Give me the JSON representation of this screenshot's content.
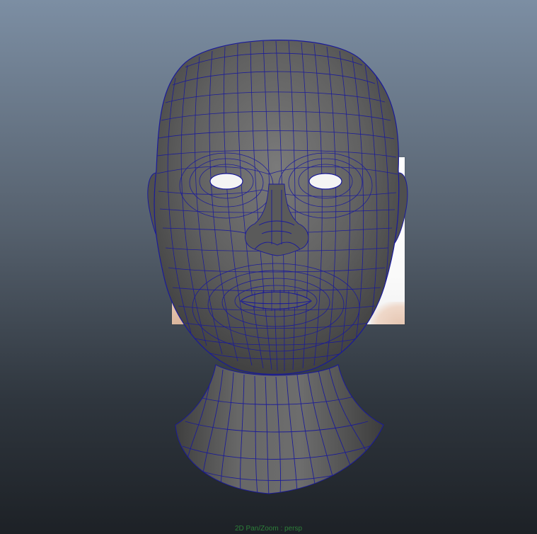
{
  "viewport": {
    "hud_label": "2D Pan/Zoom : persp",
    "hud_color": "#2f8f3d",
    "background_top": "#7c8ea3",
    "background_bottom": "#1d2126"
  },
  "model": {
    "surface_color": "#5f5f5f",
    "wireframe_color": "#1a1a9a"
  }
}
